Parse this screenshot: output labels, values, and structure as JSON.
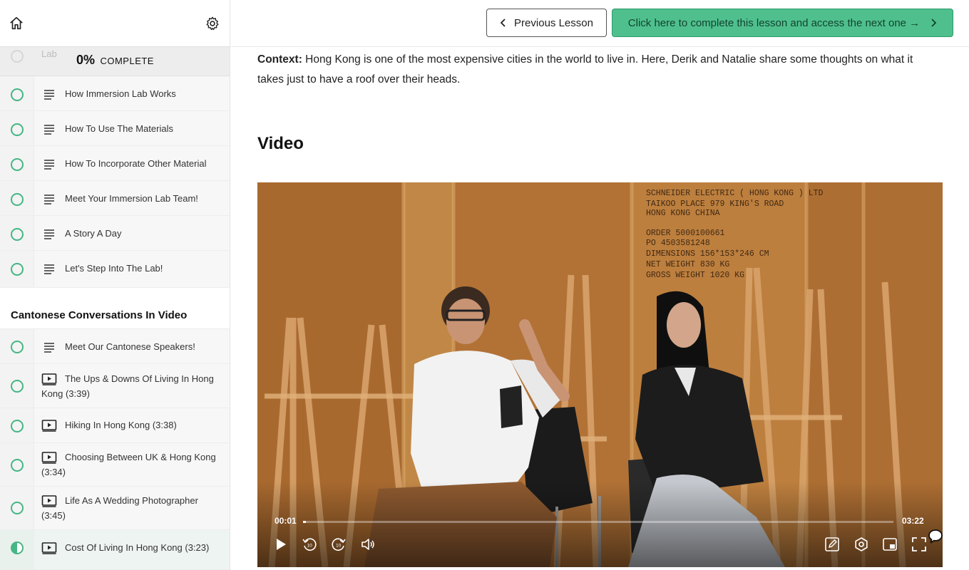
{
  "sidebar": {
    "progress": {
      "percent": "0%",
      "label": "COMPLETE",
      "ghost_item": "Lab"
    },
    "intro_items": [
      {
        "title": "How Immersion Lab Works",
        "type": "text"
      },
      {
        "title": "How To Use The Materials",
        "type": "text"
      },
      {
        "title": "How To Incorporate Other Material",
        "type": "text"
      },
      {
        "title": "Meet Your Immersion Lab Team!",
        "type": "text"
      },
      {
        "title": "A Story A Day",
        "type": "text"
      },
      {
        "title": "Let's Step Into The Lab!",
        "type": "text"
      }
    ],
    "section_title": "Cantonese Conversations In Video",
    "section_items": [
      {
        "title": "Meet Our Cantonese Speakers!",
        "type": "text"
      },
      {
        "title": "The Ups & Downs Of Living In Hong Kong (3:39)",
        "type": "video"
      },
      {
        "title": "Hiking In Hong Kong (3:38)",
        "type": "video"
      },
      {
        "title": "Choosing Between UK & Hong Kong (3:34)",
        "type": "video"
      },
      {
        "title": "Life As A Wedding Photographer (3:45)",
        "type": "video"
      },
      {
        "title": "Cost Of Living In Hong Kong (3:23)",
        "type": "video",
        "active": true
      }
    ]
  },
  "topbar": {
    "prev_label": "Previous Lesson",
    "next_label": "Click here to complete this lesson and access the next one →"
  },
  "main": {
    "context_label": "Context:",
    "context_text": " Hong Kong is one of the most expensive cities in the world to live in. Here, Derik and Natalie share some thoughts on what it takes just to have a roof over their heads.",
    "video_heading": "Video"
  },
  "player": {
    "current_time": "00:01",
    "duration": "03:22",
    "progress_fraction": 0.005,
    "crate_text": [
      "SCHNEIDER ELECTRIC ( HONG KONG ) LTD",
      "TAIKOO PLACE 979 KING'S ROAD",
      "HONG KONG CHINA",
      "ORDER          5000100661",
      "PO              4503581248",
      "DIMENSIONS    156*153*246 CM",
      "NET WEIGHT 830    KG",
      "GROSS WEIGHT 1020 KG"
    ]
  },
  "colors": {
    "accent": "#4fc08d",
    "status_circle": "#46b684"
  }
}
